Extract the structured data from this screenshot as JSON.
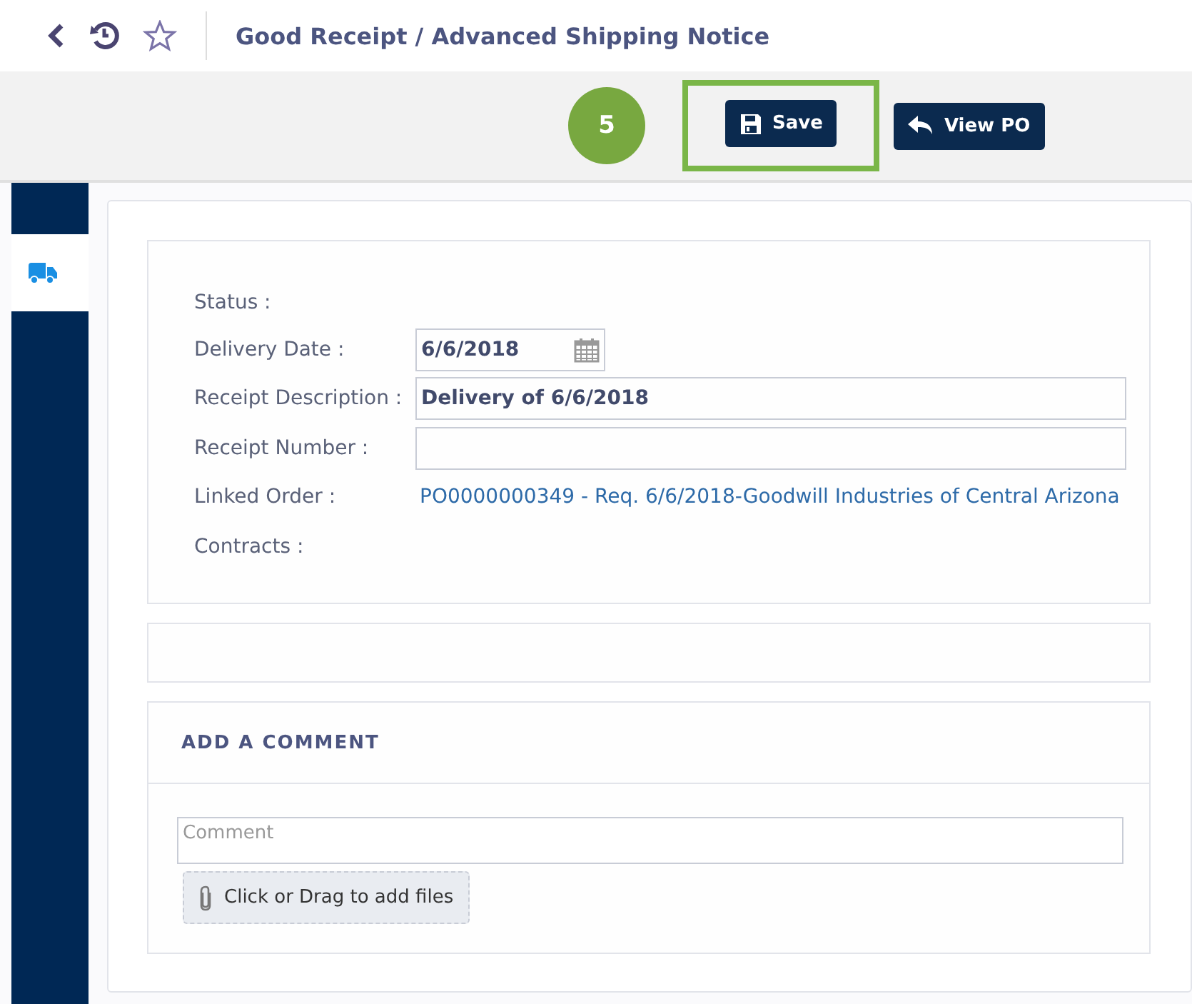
{
  "header": {
    "title": "Good Receipt / Advanced Shipping Notice"
  },
  "toolbar": {
    "step_badge": "5",
    "buttons": [
      {
        "label": "Save",
        "highlighted": true
      },
      {
        "label": "View PO",
        "highlighted": false
      }
    ]
  },
  "sidebar": {
    "tabs": [
      {
        "selected": true
      }
    ]
  },
  "form": {
    "fields": [
      {
        "label": "Status :",
        "kind": "plain"
      },
      {
        "label": "Delivery Date :",
        "kind": "date",
        "value": "6/6/2018"
      },
      {
        "label": "Receipt Description :",
        "kind": "input",
        "value": "Delivery of 6/6/2018"
      },
      {
        "label": "Receipt Number :",
        "kind": "input"
      },
      {
        "label": "Linked Order :",
        "kind": "link",
        "value": "PO0000000349 - Req. 6/6/2018-Goodwill Industries of Central Arizona"
      },
      {
        "label": "Contracts :",
        "kind": "plain"
      }
    ]
  },
  "comment": {
    "title": "ADD A COMMENT",
    "placeholder": "Comment",
    "attach_button": "Click or Drag to add files"
  }
}
